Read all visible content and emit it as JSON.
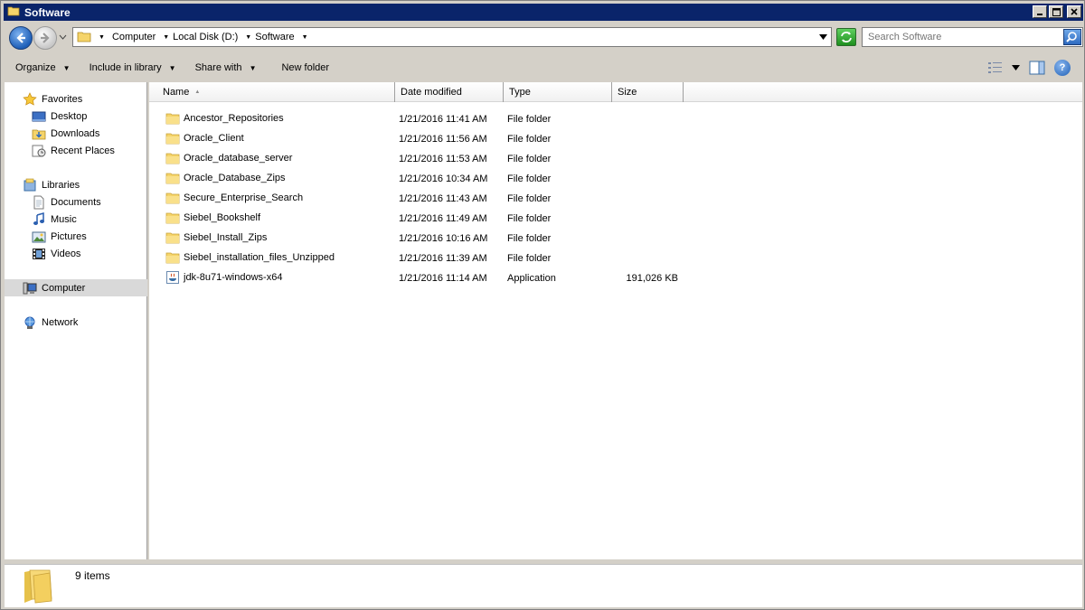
{
  "window": {
    "title": "Software"
  },
  "address": {
    "crumbs": [
      "Computer",
      "Local Disk (D:)",
      "Software"
    ]
  },
  "search": {
    "placeholder": "Search Software"
  },
  "toolbar": {
    "organize": "Organize",
    "include_in_library": "Include in library",
    "share_with": "Share with",
    "new_folder": "New folder",
    "help": "?"
  },
  "nav": {
    "favorites": "Favorites",
    "desktop": "Desktop",
    "downloads": "Downloads",
    "recent_places": "Recent Places",
    "libraries": "Libraries",
    "documents": "Documents",
    "music": "Music",
    "pictures": "Pictures",
    "videos": "Videos",
    "computer": "Computer",
    "network": "Network"
  },
  "columns": {
    "name": "Name",
    "date_modified": "Date modified",
    "type": "Type",
    "size": "Size"
  },
  "files": [
    {
      "name": "Ancestor_Repositories",
      "date": "1/21/2016 11:41 AM",
      "type": "File folder",
      "size": "",
      "icon": "folder-icon"
    },
    {
      "name": "Oracle_Client",
      "date": "1/21/2016 11:56 AM",
      "type": "File folder",
      "size": "",
      "icon": "folder-icon"
    },
    {
      "name": "Oracle_database_server",
      "date": "1/21/2016 11:53 AM",
      "type": "File folder",
      "size": "",
      "icon": "folder-icon"
    },
    {
      "name": "Oracle_Database_Zips",
      "date": "1/21/2016 10:34 AM",
      "type": "File folder",
      "size": "",
      "icon": "folder-icon"
    },
    {
      "name": "Secure_Enterprise_Search",
      "date": "1/21/2016 11:43 AM",
      "type": "File folder",
      "size": "",
      "icon": "folder-icon"
    },
    {
      "name": "Siebel_Bookshelf",
      "date": "1/21/2016 11:49 AM",
      "type": "File folder",
      "size": "",
      "icon": "folder-icon"
    },
    {
      "name": "Siebel_Install_Zips",
      "date": "1/21/2016 10:16 AM",
      "type": "File folder",
      "size": "",
      "icon": "folder-icon"
    },
    {
      "name": "Siebel_installation_files_Unzipped",
      "date": "1/21/2016 11:39 AM",
      "type": "File folder",
      "size": "",
      "icon": "folder-icon"
    },
    {
      "name": "jdk-8u71-windows-x64",
      "date": "1/21/2016 11:14 AM",
      "type": "Application",
      "size": "191,026 KB",
      "icon": "java-app-icon"
    }
  ],
  "status": {
    "count": "9 items"
  }
}
